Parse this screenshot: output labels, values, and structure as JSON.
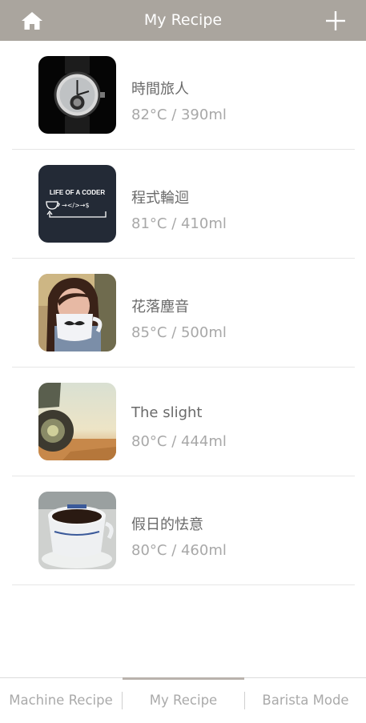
{
  "header": {
    "title": "My Recipe",
    "home_icon": "home-icon",
    "add_icon": "plus-icon",
    "bg_color": "#aaa59e"
  },
  "recipes": [
    {
      "name": "時間旅人",
      "detail": "82°C / 390ml",
      "thumbnail": "wristwatch-photo"
    },
    {
      "name": "程式輪迴",
      "detail": "81°C / 410ml",
      "thumbnail": "life-of-a-coder-graphic",
      "thumbnail_text": "LIFE OF A CODER"
    },
    {
      "name": "花落塵音",
      "detail": "85°C / 500ml",
      "thumbnail": "person-with-mustache-mug-photo"
    },
    {
      "name": "The slight",
      "detail": "80°C / 444ml",
      "thumbnail": "tractor-wheel-photo"
    },
    {
      "name": "假日的怯意",
      "detail": "80°C / 460ml",
      "thumbnail": "coffee-cup-photo"
    }
  ],
  "tabs": [
    {
      "label": "Machine Recipe",
      "active": false
    },
    {
      "label": "My Recipe",
      "active": true
    },
    {
      "label": "Barista Mode",
      "active": false
    }
  ]
}
